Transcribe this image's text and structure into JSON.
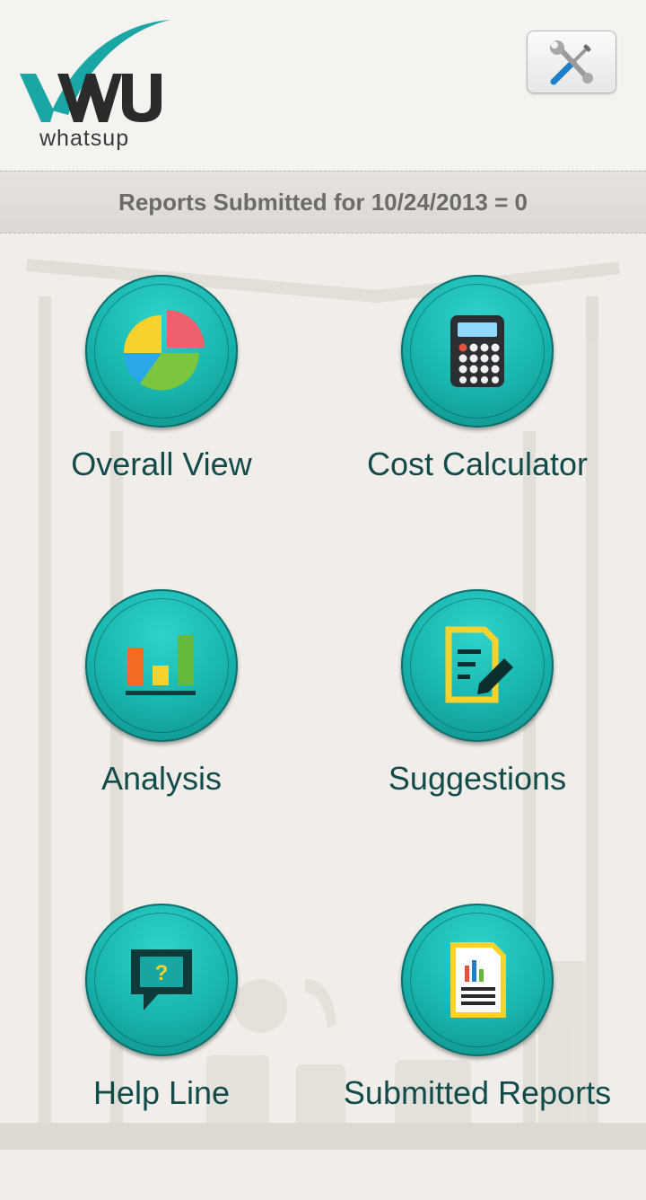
{
  "app": {
    "logo_text": "whatsup"
  },
  "header": {
    "settings_icon": "tools-icon"
  },
  "status": {
    "text": "Reports Submitted for 10/24/2013 = 0"
  },
  "menu": {
    "items": [
      {
        "label": "Overall View",
        "icon": "pie-chart-icon"
      },
      {
        "label": "Cost Calculator",
        "icon": "calculator-icon"
      },
      {
        "label": "Analysis",
        "icon": "bar-chart-icon"
      },
      {
        "label": "Suggestions",
        "icon": "edit-document-icon"
      },
      {
        "label": "Help Line",
        "icon": "help-chat-icon"
      },
      {
        "label": "Submitted Reports",
        "icon": "report-document-icon"
      }
    ]
  },
  "colors": {
    "accent": "#18b3ad",
    "label": "#124b4b",
    "status_text": "#6d6b68"
  }
}
